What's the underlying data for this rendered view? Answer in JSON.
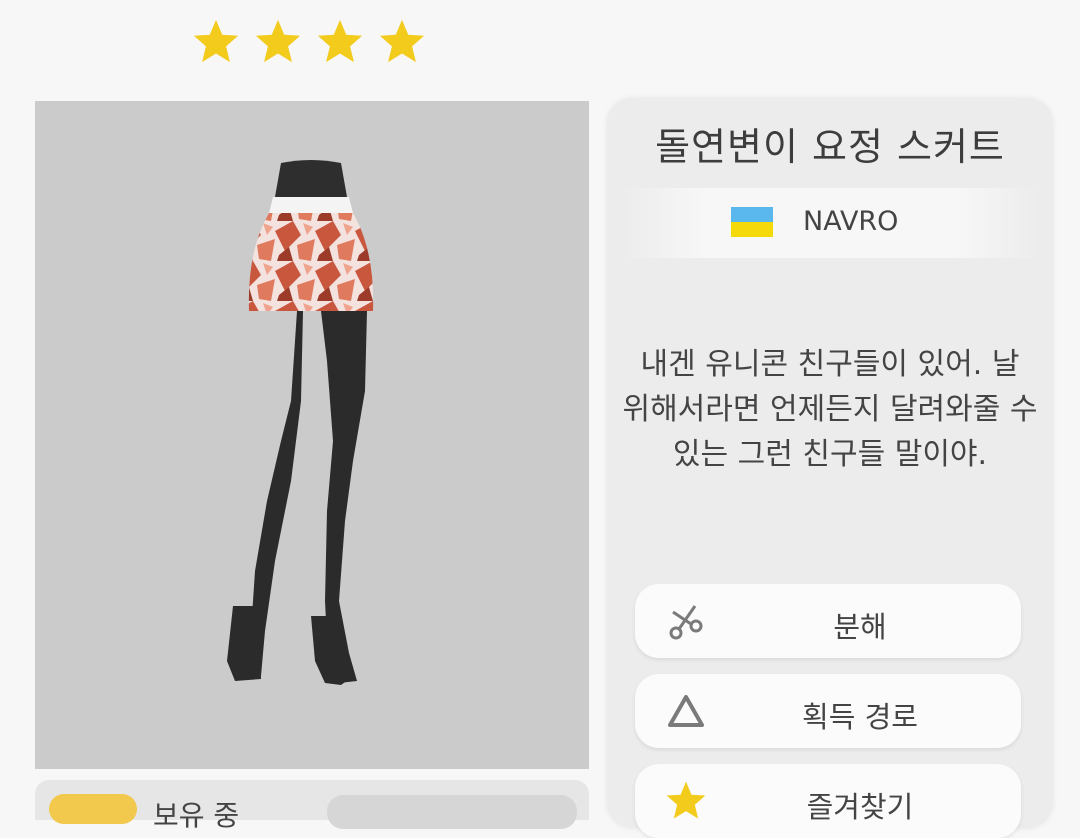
{
  "rating": {
    "stars": 4
  },
  "item": {
    "name": "돌연변이 요정 스커트",
    "brand": "NAVRO",
    "description_lines": [
      "내겐 유니콘 친구들이 있어. 날",
      "위해서라면 언제든지 달려와줄 수",
      "있는 그런 친구들 말이야."
    ]
  },
  "actions": {
    "decompose_label": "분해",
    "acquire_path_label": "획득 경로",
    "favorite_label": "즐겨찾기"
  },
  "footer": {
    "owned_label": "보유 중"
  },
  "colors": {
    "star": "#f2cb1c",
    "flag_blue": "#5bb8ee",
    "flag_yellow": "#f5d90a",
    "preview_bg": "#cbcbcb",
    "panel_bg": "#ececec"
  },
  "icons": [
    "star-icon",
    "ukraine-flag-icon",
    "scissors-icon",
    "triangle-icon"
  ]
}
